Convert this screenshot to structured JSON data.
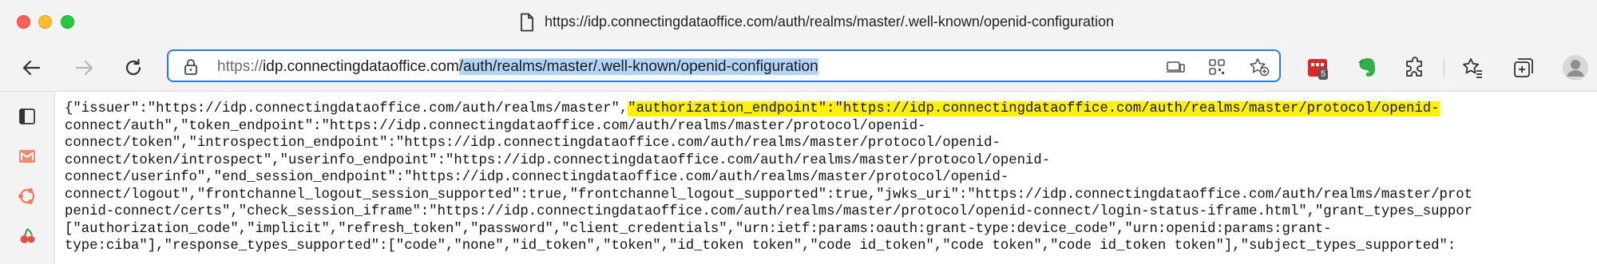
{
  "window": {
    "title": "https://idp.connectingdataoffice.com/auth/realms/master/.well-known/openid-configuration"
  },
  "address_bar": {
    "scheme": "https://",
    "host": "idp.connectingdataoffice.com",
    "path_selected": "/auth/realms/master/.well-known/openid-configuration"
  },
  "toolbar": {
    "extension_badge": "5"
  },
  "colors": {
    "highlight": "#fff200",
    "selection": "#b3d4fb",
    "omnibox_border": "#2f7bd9"
  },
  "json_lines": [
    [
      {
        "text": "{\"issuer\":\"https://idp.connectingdataoffice.com/auth/realms/master\","
      },
      {
        "text": "\"authorization_endpoint\":\"https://idp.connectingdataoffice.com/auth/realms/master/protocol/openid-",
        "hl": true
      }
    ],
    [
      {
        "text": "connect/auth\",\"token_endpoint\":\"https://idp.connectingdataoffice.com/auth/realms/master/protocol/openid-"
      }
    ],
    [
      {
        "text": "connect/token\",\"introspection_endpoint\":\"https://idp.connectingdataoffice.com/auth/realms/master/protocol/openid-"
      }
    ],
    [
      {
        "text": "connect/token/introspect\",\"userinfo_endpoint\":\"https://idp.connectingdataoffice.com/auth/realms/master/protocol/openid-"
      }
    ],
    [
      {
        "text": "connect/userinfo\",\"end_session_endpoint\":\"https://idp.connectingdataoffice.com/auth/realms/master/protocol/openid-"
      }
    ],
    [
      {
        "text": "connect/logout\",\"frontchannel_logout_session_supported\":true,\"frontchannel_logout_supported\":true,\"jwks_uri\":\"https://idp.connectingdataoffice.com/auth/realms/master/prot"
      }
    ],
    [
      {
        "text": "penid-connect/certs\",\"check_session_iframe\":\"https://idp.connectingdataoffice.com/auth/realms/master/protocol/openid-connect/login-status-iframe.html\",\"grant_types_suppor"
      }
    ],
    [
      {
        "text": "[\"authorization_code\",\"implicit\",\"refresh_token\",\"password\",\"client_credentials\",\"urn:ietf:params:oauth:grant-type:device_code\",\"urn:openid:params:grant-"
      }
    ],
    [
      {
        "text": "type:ciba\"],\"response_types_supported\":[\"code\",\"none\",\"id_token\",\"token\",\"id_token token\",\"code id_token\",\"code token\",\"code id_token token\"],\"subject_types_supported\":"
      }
    ]
  ]
}
